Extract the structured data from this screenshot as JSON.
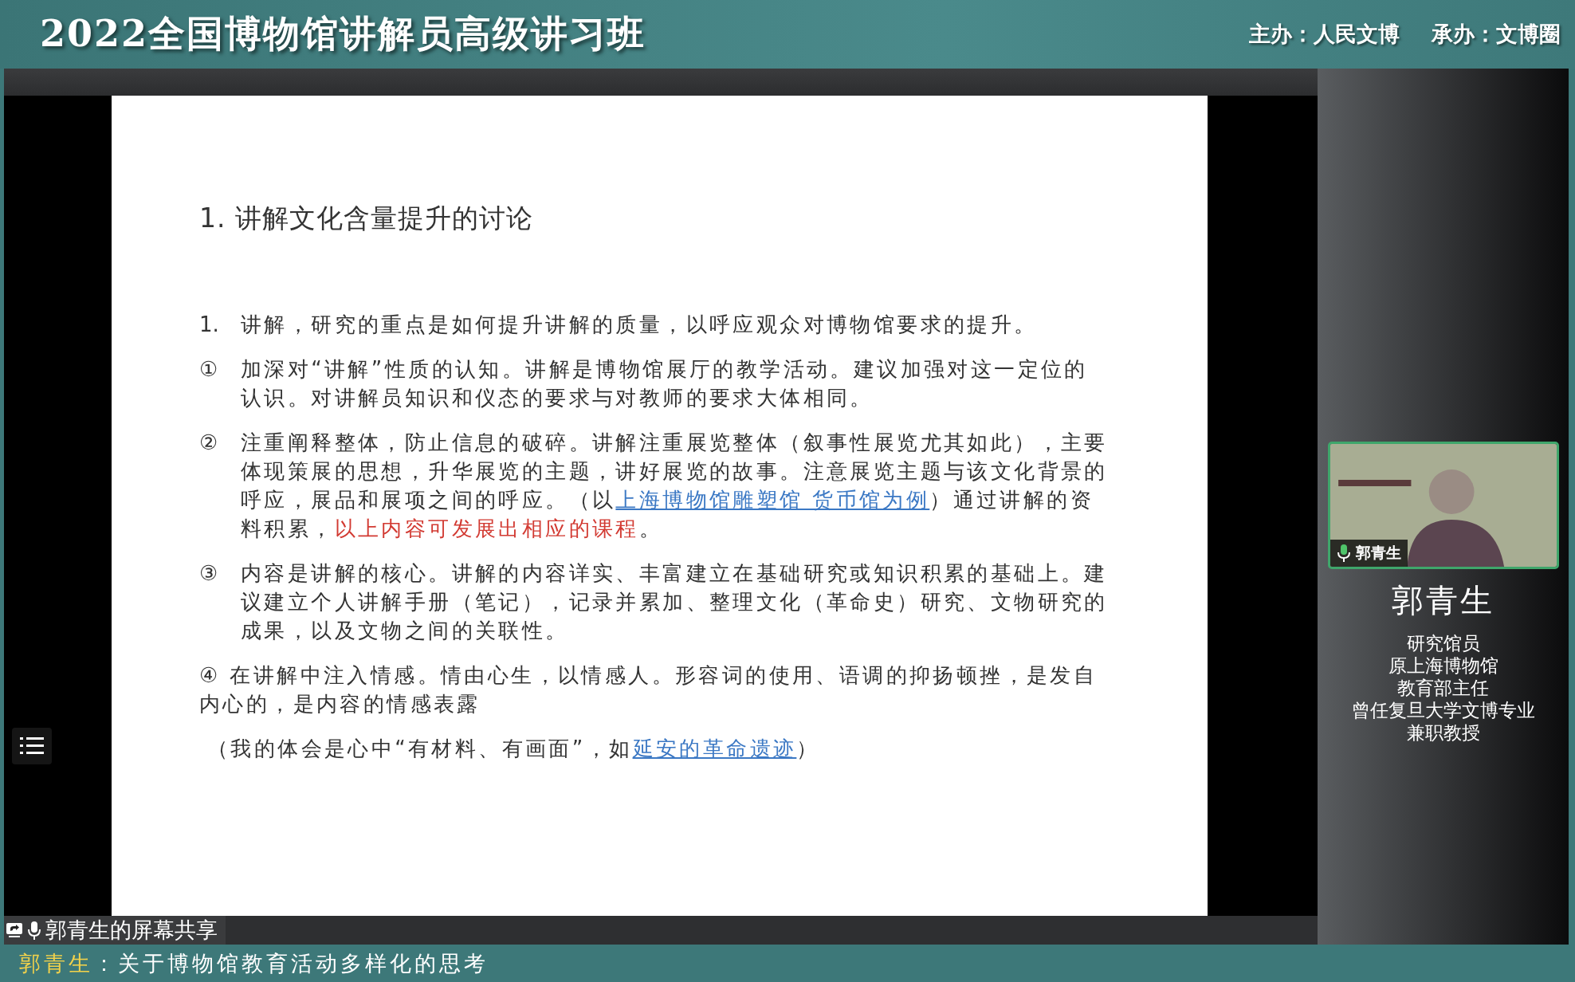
{
  "header": {
    "title": "2022全国博物馆讲解员高级讲习班",
    "organizers": [
      "主办：人民文博",
      "承办：文博圈"
    ]
  },
  "slide": {
    "heading": "1. 讲解文化含量提升的讨论",
    "items": [
      {
        "kind": "hanging",
        "marker": "1.",
        "segments": [
          {
            "kind": "text",
            "text": "讲解，研究的重点是如何提升讲解的质量，以呼应观众对博物馆要求的提升。"
          }
        ]
      },
      {
        "kind": "hanging",
        "marker": "①",
        "segments": [
          {
            "kind": "text",
            "text": "加深对“讲解”性质的认知。讲解是博物馆展厅的教学活动。建议加强对这一定位的认识。对讲解员知识和仪态的要求与对教师的要求大体相同。"
          }
        ]
      },
      {
        "kind": "hanging",
        "marker": "②",
        "segments": [
          {
            "kind": "text",
            "text": "注重阐释整体，防止信息的破碎。讲解注重展览整体（叙事性展览尤其如此），主要体现策展的思想，升华展览的主题，讲好展览的故事。注意展览主题与该文化背景的呼应，展品和展项之间的呼应。（以"
          },
          {
            "kind": "link",
            "text": "上海博物馆雕塑馆 货币馆为例"
          },
          {
            "kind": "text",
            "text": "）通过讲解的资料积累，"
          },
          {
            "kind": "highlight",
            "text": "以上内容可发展出相应的课程"
          },
          {
            "kind": "text",
            "text": "。"
          }
        ]
      },
      {
        "kind": "hanging",
        "marker": "③",
        "segments": [
          {
            "kind": "text",
            "text": "内容是讲解的核心。讲解的内容详实、丰富建立在基础研究或知识积累的基础上。建议建立个人讲解手册（笔记），记录并累加、整理文化（革命史）研究、文物研究的成果，以及文物之间的关联性。"
          }
        ]
      },
      {
        "kind": "inline",
        "marker": "④",
        "segments": [
          {
            "kind": "text",
            "text": "在讲解中注入情感。情由心生，以情感人。形容词的使用、语调的抑扬顿挫，是发自内心的，是内容的情感表露"
          }
        ]
      },
      {
        "kind": "plain",
        "segments": [
          {
            "kind": "text",
            "text": "（我的体会是心中“有材料、有画面”，如"
          },
          {
            "kind": "link",
            "text": "延安的革命遗迹"
          },
          {
            "kind": "text",
            "text": "）"
          }
        ]
      }
    ]
  },
  "video_tile": {
    "label": "郭青生"
  },
  "speaker": {
    "name": "郭青生",
    "titles": [
      "研究馆员",
      "原上海博物馆",
      "教育部主任",
      "曾任复旦大学文博专业",
      "兼职教授"
    ]
  },
  "share_label": "郭青生的屏幕共享",
  "caption": {
    "speaker": "郭青生",
    "text": "：关于博物馆教育活动多样化的思考"
  }
}
